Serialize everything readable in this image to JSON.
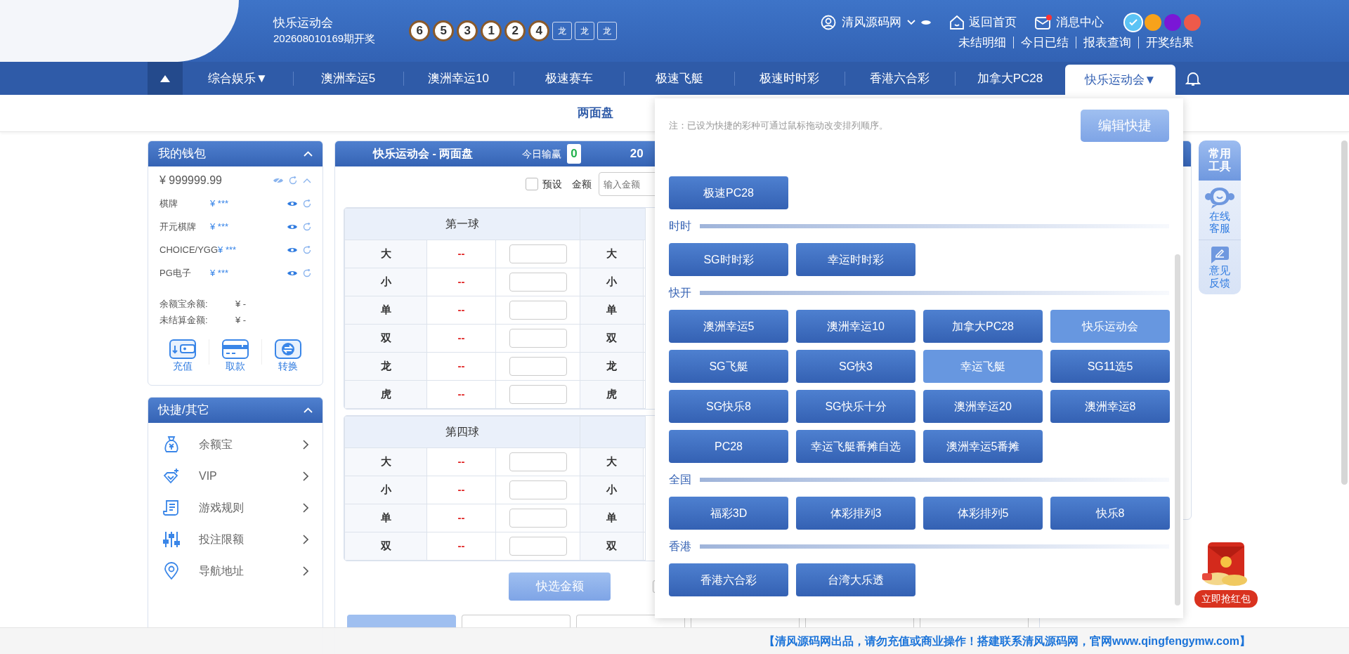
{
  "header": {
    "title": "快乐运动会",
    "period": "202608010169期开奖",
    "balls": [
      "6",
      "5",
      "3",
      "1",
      "2",
      "4"
    ],
    "tags": [
      "龙",
      "龙",
      "龙"
    ],
    "user": "清风源码网",
    "home": "返回首页",
    "messages": {
      "label": "消息中心",
      "unread": true
    },
    "themes": [
      {
        "color": "#5bc3f5",
        "selected": true
      },
      {
        "color": "#f7a21b",
        "selected": false
      },
      {
        "color": "#7a17d6",
        "selected": false
      },
      {
        "color": "#ee5a4a",
        "selected": false
      }
    ],
    "links": [
      "未结明细",
      "今日已结",
      "报表查询",
      "开奖结果"
    ]
  },
  "nav": {
    "items": [
      {
        "label": "综合娱乐▼",
        "selected": false
      },
      {
        "label": "澳洲幸运5",
        "selected": false
      },
      {
        "label": "澳洲幸运10",
        "selected": false
      },
      {
        "label": "极速赛车",
        "selected": false
      },
      {
        "label": "极速飞艇",
        "selected": false
      },
      {
        "label": "极速时时彩",
        "selected": false
      },
      {
        "label": "香港六合彩",
        "selected": false
      },
      {
        "label": "加拿大PC28",
        "selected": false
      },
      {
        "label": "快乐运动会▼",
        "selected": true
      }
    ]
  },
  "subnav": {
    "label": "两面盘"
  },
  "wallet": {
    "title": "我的钱包",
    "balance": "¥ 999999.99",
    "accounts": [
      {
        "name": "棋牌",
        "amount": "¥ ***"
      },
      {
        "name": "开元棋牌",
        "amount": "¥ ***"
      },
      {
        "name": "CHOICE/YGG",
        "amount": "¥ ***"
      },
      {
        "name": "PG电子",
        "amount": "¥ ***"
      }
    ],
    "summary": [
      {
        "label": "余额宝余额:",
        "value": "¥ -"
      },
      {
        "label": "未结算金额:",
        "value": "¥ -"
      }
    ],
    "actions": [
      {
        "label": "充值",
        "kind": "deposit"
      },
      {
        "label": "取款",
        "kind": "withdraw"
      },
      {
        "label": "转换",
        "kind": "transfer"
      }
    ]
  },
  "shortcuts": {
    "title": "快捷/其它",
    "items": [
      {
        "label": "余额宝",
        "kind": "savings"
      },
      {
        "label": "VIP",
        "kind": "vip"
      },
      {
        "label": "游戏规则",
        "kind": "rules"
      },
      {
        "label": "投注限额",
        "kind": "limits"
      },
      {
        "label": "导航地址",
        "kind": "location"
      }
    ]
  },
  "bet_panel": {
    "title": "快乐运动会 - 两面盘",
    "today_label": "今日输赢",
    "today_value": "0",
    "cut_text": "20",
    "preset": {
      "label": "预设",
      "checked": false
    },
    "amount_label": "金额",
    "amount_placeholder": "输入金额",
    "tables": [
      {
        "heading": "第一球",
        "rows": [
          {
            "label": "大",
            "odds": "--",
            "next_label": "大"
          },
          {
            "label": "小",
            "odds": "--",
            "next_label": "小"
          },
          {
            "label": "单",
            "odds": "--",
            "next_label": "单"
          },
          {
            "label": "双",
            "odds": "--",
            "next_label": "双"
          },
          {
            "label": "龙",
            "odds": "--",
            "next_label": "龙"
          },
          {
            "label": "虎",
            "odds": "--",
            "next_label": "虎"
          }
        ]
      },
      {
        "heading": "第四球",
        "rows": [
          {
            "label": "大",
            "odds": "--",
            "next_label": "大"
          },
          {
            "label": "小",
            "odds": "--",
            "next_label": "小"
          },
          {
            "label": "单",
            "odds": "--",
            "next_label": "单"
          },
          {
            "label": "双",
            "odds": "--",
            "next_label": "双"
          }
        ]
      }
    ],
    "quick_button": "快选金额",
    "second_check": {
      "checked": false
    },
    "tabs": [
      {
        "selected": true
      },
      {
        "selected": false
      },
      {
        "selected": false
      },
      {
        "selected": false
      },
      {
        "selected": false
      },
      {
        "selected": false
      }
    ]
  },
  "dropdown": {
    "note": "注：已设为快捷的彩种可通过鼠标拖动改变排列顺序。",
    "edit_button": "编辑快捷",
    "sections": [
      {
        "items": [
          {
            "label": "极速PC28",
            "selected": false
          }
        ]
      },
      {
        "title": "时时",
        "items": [
          {
            "label": "SG时时彩",
            "selected": false
          },
          {
            "label": "幸运时时彩",
            "selected": false
          }
        ]
      },
      {
        "title": "快开",
        "items": [
          {
            "label": "澳洲幸运5",
            "selected": false
          },
          {
            "label": "澳洲幸运10",
            "selected": false
          },
          {
            "label": "加拿大PC28",
            "selected": false
          },
          {
            "label": "快乐运动会",
            "selected": true
          },
          {
            "label": "SG飞艇",
            "selected": false
          },
          {
            "label": "SG快3",
            "selected": false
          },
          {
            "label": "幸运飞艇",
            "selected": true
          },
          {
            "label": "SG11选5",
            "selected": false
          },
          {
            "label": "SG快乐8",
            "selected": false
          },
          {
            "label": "SG快乐十分",
            "selected": false
          },
          {
            "label": "澳洲幸运20",
            "selected": false
          },
          {
            "label": "澳洲幸运8",
            "selected": false
          },
          {
            "label": "PC28",
            "selected": false
          },
          {
            "label": "幸运飞艇番摊自选",
            "selected": false
          },
          {
            "label": "澳洲幸运5番摊",
            "selected": false
          }
        ]
      },
      {
        "title": "全国",
        "items": [
          {
            "label": "福彩3D",
            "selected": false
          },
          {
            "label": "体彩排列3",
            "selected": false
          },
          {
            "label": "体彩排列5",
            "selected": false
          },
          {
            "label": "快乐8",
            "selected": false
          }
        ]
      },
      {
        "title": "香港",
        "items": [
          {
            "label": "香港六合彩",
            "selected": false
          },
          {
            "label": "台湾大乐透",
            "selected": false
          }
        ]
      }
    ]
  },
  "tools": {
    "title": "常用工具",
    "items": [
      {
        "label": "在线客服",
        "kind": "support"
      },
      {
        "label": "意见反馈",
        "kind": "feedback"
      }
    ]
  },
  "red_packet": {
    "button": "立即抢红包"
  },
  "notice": "【清风源码网出品，请勿充值或商业操作！搭建联系清风源码网，官网www.qingfengymw.com】"
}
